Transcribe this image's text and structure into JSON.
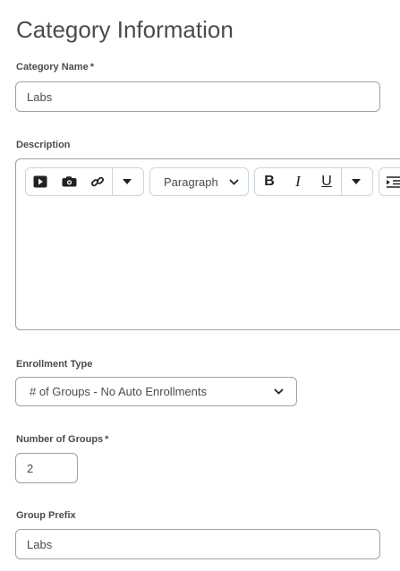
{
  "heading": "Category Information",
  "category_name": {
    "label": "Category Name",
    "required_mark": "*",
    "value": "Labs"
  },
  "description": {
    "label": "Description",
    "toolbar": {
      "insert_stuff_icon": "play-icon",
      "insert_quicklink_icon": "camera-icon",
      "link_icon": "link-icon",
      "more_icon": "caret-down-icon",
      "block_format": "Paragraph",
      "bold": "B",
      "italic": "I",
      "underline": "U",
      "more_format_icon": "caret-down-icon",
      "indent_icon": "indent-icon"
    }
  },
  "enrollment_type": {
    "label": "Enrollment Type",
    "value": "# of Groups - No Auto Enrollments"
  },
  "number_of_groups": {
    "label": "Number of Groups",
    "required_mark": "*",
    "value": "2"
  },
  "group_prefix": {
    "label": "Group Prefix",
    "value": "Labs"
  }
}
